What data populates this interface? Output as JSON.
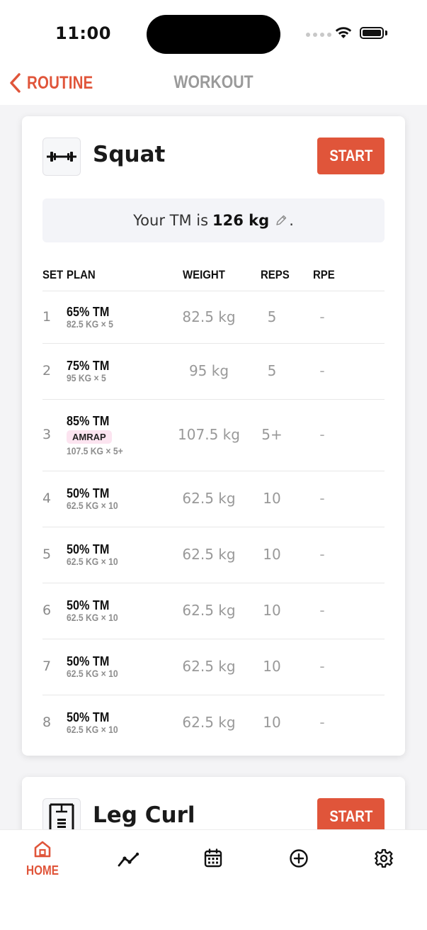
{
  "status": {
    "time": "11:00"
  },
  "nav": {
    "back_label": "ROUTINE",
    "title": "WORKOUT"
  },
  "exercises": [
    {
      "name": "Squat",
      "start_label": "START",
      "tm_prefix": "Your TM is",
      "tm_value": "126 kg",
      "tm_suffix": ".",
      "columns": {
        "set": "SET",
        "plan": "PLAN",
        "weight": "WEIGHT",
        "reps": "REPS",
        "rpe": "RPE"
      },
      "sets": [
        {
          "set": "1",
          "plan": "65% TM",
          "badge": "",
          "sub": "82.5 KG × 5",
          "weight": "82.5 kg",
          "reps": "5",
          "rpe": "-"
        },
        {
          "set": "2",
          "plan": "75% TM",
          "badge": "",
          "sub": "95 KG × 5",
          "weight": "95 kg",
          "reps": "5",
          "rpe": "-"
        },
        {
          "set": "3",
          "plan": "85% TM",
          "badge": "AMRAP",
          "sub": "107.5 KG × 5+",
          "weight": "107.5 kg",
          "reps": "5+",
          "rpe": "-"
        },
        {
          "set": "4",
          "plan": "50% TM",
          "badge": "",
          "sub": "62.5 KG × 10",
          "weight": "62.5 kg",
          "reps": "10",
          "rpe": "-"
        },
        {
          "set": "5",
          "plan": "50% TM",
          "badge": "",
          "sub": "62.5 KG × 10",
          "weight": "62.5 kg",
          "reps": "10",
          "rpe": "-"
        },
        {
          "set": "6",
          "plan": "50% TM",
          "badge": "",
          "sub": "62.5 KG × 10",
          "weight": "62.5 kg",
          "reps": "10",
          "rpe": "-"
        },
        {
          "set": "7",
          "plan": "50% TM",
          "badge": "",
          "sub": "62.5 KG × 10",
          "weight": "62.5 kg",
          "reps": "10",
          "rpe": "-"
        },
        {
          "set": "8",
          "plan": "50% TM",
          "badge": "",
          "sub": "62.5 KG × 10",
          "weight": "62.5 kg",
          "reps": "10",
          "rpe": "-"
        }
      ]
    },
    {
      "name": "Leg Curl",
      "start_label": "START"
    }
  ],
  "tabs": [
    {
      "id": "home",
      "label": "HOME",
      "icon": "home-icon",
      "active": true
    },
    {
      "id": "progress",
      "label": "",
      "icon": "chart-line-icon",
      "active": false
    },
    {
      "id": "calendar",
      "label": "",
      "icon": "calendar-icon",
      "active": false
    },
    {
      "id": "add",
      "label": "",
      "icon": "plus-circle-icon",
      "active": false
    },
    {
      "id": "settings",
      "label": "",
      "icon": "gear-icon",
      "active": false
    }
  ],
  "colors": {
    "accent": "#e0553a",
    "muted": "#9a9a9a",
    "badge_bg": "#fce4f0"
  }
}
